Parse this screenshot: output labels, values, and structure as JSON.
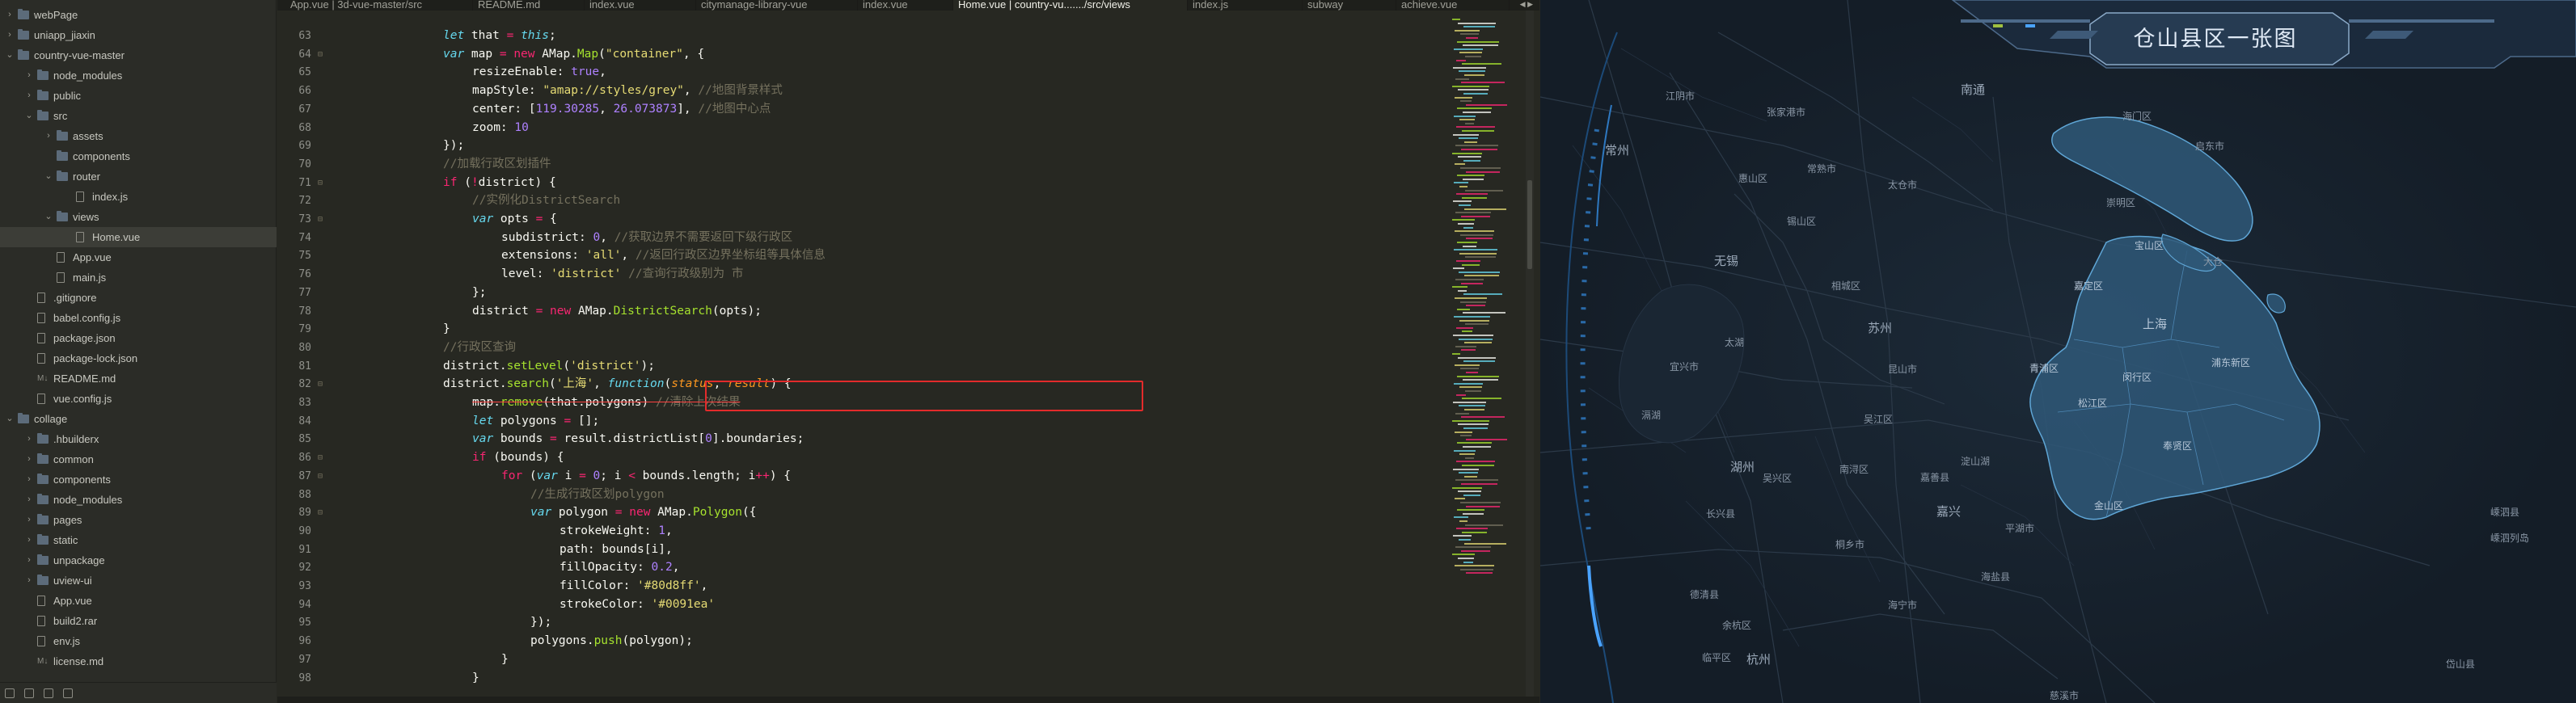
{
  "sidebar": {
    "items": [
      {
        "label": "webPage",
        "type": "folder",
        "depth": 0,
        "arrow": "›"
      },
      {
        "label": "uniapp_jiaxin",
        "type": "folder",
        "depth": 0,
        "arrow": "›"
      },
      {
        "label": "country-vue-master",
        "type": "folder",
        "depth": 0,
        "arrow": "⌄"
      },
      {
        "label": "node_modules",
        "type": "folder",
        "depth": 1,
        "arrow": "›"
      },
      {
        "label": "public",
        "type": "folder",
        "depth": 1,
        "arrow": "›"
      },
      {
        "label": "src",
        "type": "folder",
        "depth": 1,
        "arrow": "⌄"
      },
      {
        "label": "assets",
        "type": "folder",
        "depth": 2,
        "arrow": "›"
      },
      {
        "label": "components",
        "type": "folder",
        "depth": 2,
        "arrow": ""
      },
      {
        "label": "router",
        "type": "folder",
        "depth": 2,
        "arrow": "⌄"
      },
      {
        "label": "index.js",
        "type": "file",
        "depth": 3,
        "arrow": ""
      },
      {
        "label": "views",
        "type": "folder",
        "depth": 2,
        "arrow": "⌄"
      },
      {
        "label": "Home.vue",
        "type": "file",
        "depth": 3,
        "arrow": "",
        "selected": true
      },
      {
        "label": "App.vue",
        "type": "file",
        "depth": 2,
        "arrow": ""
      },
      {
        "label": "main.js",
        "type": "file",
        "depth": 2,
        "arrow": ""
      },
      {
        "label": ".gitignore",
        "type": "file",
        "depth": 1,
        "arrow": ""
      },
      {
        "label": "babel.config.js",
        "type": "file",
        "depth": 1,
        "arrow": ""
      },
      {
        "label": "package.json",
        "type": "json",
        "depth": 1,
        "arrow": ""
      },
      {
        "label": "package-lock.json",
        "type": "json",
        "depth": 1,
        "arrow": ""
      },
      {
        "label": "README.md",
        "type": "md",
        "depth": 1,
        "arrow": ""
      },
      {
        "label": "vue.config.js",
        "type": "file",
        "depth": 1,
        "arrow": ""
      },
      {
        "label": "collage",
        "type": "folder",
        "depth": 0,
        "arrow": "⌄"
      },
      {
        "label": ".hbuilderx",
        "type": "folder",
        "depth": 1,
        "arrow": "›"
      },
      {
        "label": "common",
        "type": "folder",
        "depth": 1,
        "arrow": "›"
      },
      {
        "label": "components",
        "type": "folder",
        "depth": 1,
        "arrow": "›"
      },
      {
        "label": "node_modules",
        "type": "folder",
        "depth": 1,
        "arrow": "›"
      },
      {
        "label": "pages",
        "type": "folder",
        "depth": 1,
        "arrow": "›"
      },
      {
        "label": "static",
        "type": "folder",
        "depth": 1,
        "arrow": "›"
      },
      {
        "label": "unpackage",
        "type": "folder",
        "depth": 1,
        "arrow": "›"
      },
      {
        "label": "uview-ui",
        "type": "folder",
        "depth": 1,
        "arrow": "›"
      },
      {
        "label": "App.vue",
        "type": "file",
        "depth": 1,
        "arrow": ""
      },
      {
        "label": "build2.rar",
        "type": "file",
        "depth": 1,
        "arrow": ""
      },
      {
        "label": "env.js",
        "type": "file",
        "depth": 1,
        "arrow": ""
      },
      {
        "label": "license.md",
        "type": "md",
        "depth": 1,
        "arrow": ""
      }
    ]
  },
  "tabs": [
    {
      "label": "App.vue | 3d-vue-master/src",
      "active": false
    },
    {
      "label": "README.md",
      "active": false
    },
    {
      "label": "index.vue",
      "active": false
    },
    {
      "label": "citymanage-library-vue",
      "active": false
    },
    {
      "label": "index.vue",
      "active": false
    },
    {
      "label": "Home.vue | country-vu......./src/views",
      "active": true
    },
    {
      "label": "index.js",
      "active": false
    },
    {
      "label": "subway",
      "active": false
    },
    {
      "label": "achieve.vue",
      "active": false
    }
  ],
  "tabs_scroll": "◀ ▶",
  "editor": {
    "code": [
      {
        "n": "63",
        "fold": "",
        "indent": 0,
        "html": "<span class='kw'>let</span> that <span class='op'>=</span> <span class='kw'>this</span>;"
      },
      {
        "n": "64",
        "fold": "⊟",
        "indent": 0,
        "html": "<span class='kw'>var</span> map <span class='op'>=</span> <span class='op'>new</span> AMap.<span class='fn'>Map</span>(<span class='str'>\"container\"</span>, {"
      },
      {
        "n": "65",
        "fold": "",
        "indent": 1,
        "html": "resizeEnable: <span class='num'>true</span>,"
      },
      {
        "n": "66",
        "fold": "",
        "indent": 1,
        "html": "mapStyle: <span class='str'>\"amap://styles/grey\"</span>, <span class='cm'>//地图背景样式</span>"
      },
      {
        "n": "67",
        "fold": "",
        "indent": 1,
        "html": "center: [<span class='num'>119.30285</span>, <span class='num'>26.073873</span>], <span class='cm'>//地图中心点</span>"
      },
      {
        "n": "68",
        "fold": "",
        "indent": 1,
        "html": "zoom: <span class='num'>10</span>"
      },
      {
        "n": "69",
        "fold": "",
        "indent": 0,
        "html": "});"
      },
      {
        "n": "70",
        "fold": "",
        "indent": 0,
        "html": "<span class='cm'>//加载行政区划插件</span>"
      },
      {
        "n": "71",
        "fold": "⊟",
        "indent": 0,
        "html": "<span class='op'>if</span> (<span class='op'>!</span>district) {"
      },
      {
        "n": "72",
        "fold": "",
        "indent": 1,
        "html": "<span class='cm'>//实例化DistrictSearch</span>"
      },
      {
        "n": "73",
        "fold": "⊟",
        "indent": 1,
        "html": "<span class='kw'>var</span> opts <span class='op'>=</span> {"
      },
      {
        "n": "74",
        "fold": "",
        "indent": 2,
        "html": "subdistrict: <span class='num'>0</span>, <span class='cm'>//获取边界不需要返回下级行政区</span>"
      },
      {
        "n": "75",
        "fold": "",
        "indent": 2,
        "html": "extensions: <span class='str'>'all'</span>, <span class='cm'>//返回行政区边界坐标组等具体信息</span>"
      },
      {
        "n": "76",
        "fold": "",
        "indent": 2,
        "html": "level: <span class='str'>'district'</span> <span class='cm'>//查询行政级别为 市</span>"
      },
      {
        "n": "77",
        "fold": "",
        "indent": 1,
        "html": "};"
      },
      {
        "n": "78",
        "fold": "",
        "indent": 1,
        "html": "district <span class='op'>=</span> <span class='op'>new</span> AMap.<span class='fn'>DistrictSearch</span>(opts);"
      },
      {
        "n": "79",
        "fold": "",
        "indent": 0,
        "html": "}"
      },
      {
        "n": "80",
        "fold": "",
        "indent": 0,
        "html": "<span class='cm'>//行政区查询</span>"
      },
      {
        "n": "81",
        "fold": "",
        "indent": 0,
        "html": "district.<span class='fn'>setLevel</span>(<span class='str'>'district'</span>);"
      },
      {
        "n": "82",
        "fold": "⊟",
        "indent": 0,
        "html": "district.<span class='fn'>search</span>(<span class='str'>'上海'</span>, <span class='kw'>function</span>(<span class='prm'>status</span>, <span class='prm'>result</span>) {"
      },
      {
        "n": "83",
        "fold": "",
        "indent": 1,
        "html": "<span class='strike'>map.<span class='fn'>remove</span>(that.polygons) <span class='cm'>//清除上次结果</span></span>"
      },
      {
        "n": "84",
        "fold": "",
        "indent": 1,
        "html": "<span class='kw'>let</span> polygons <span class='op'>=</span> [];"
      },
      {
        "n": "85",
        "fold": "",
        "indent": 1,
        "html": "<span class='kw'>var</span> bounds <span class='op'>=</span> result.districtList[<span class='num'>0</span>].boundaries;"
      },
      {
        "n": "86",
        "fold": "⊟",
        "indent": 1,
        "html": "<span class='op'>if</span> (bounds) {"
      },
      {
        "n": "87",
        "fold": "⊟",
        "indent": 2,
        "html": "<span class='op'>for</span> (<span class='kw'>var</span> i <span class='op'>=</span> <span class='num'>0</span>; i <span class='op'>&lt;</span> bounds.length; i<span class='op'>++</span>) {"
      },
      {
        "n": "88",
        "fold": "",
        "indent": 3,
        "html": "<span class='cm'>//生成行政区划polygon</span>"
      },
      {
        "n": "89",
        "fold": "⊟",
        "indent": 3,
        "html": "<span class='kw'>var</span> polygon <span class='op'>=</span> <span class='op'>new</span> AMap.<span class='fn'>Polygon</span>({"
      },
      {
        "n": "90",
        "fold": "",
        "indent": 4,
        "html": "strokeWeight: <span class='num'>1</span>,"
      },
      {
        "n": "91",
        "fold": "",
        "indent": 4,
        "html": "path: bounds[i],"
      },
      {
        "n": "92",
        "fold": "",
        "indent": 4,
        "html": "fillOpacity: <span class='num'>0.2</span>,"
      },
      {
        "n": "93",
        "fold": "",
        "indent": 4,
        "html": "fillColor: <span class='str'>'#80d8ff'</span>,"
      },
      {
        "n": "94",
        "fold": "",
        "indent": 4,
        "html": "strokeColor: <span class='str'>'#0091ea'</span>"
      },
      {
        "n": "95",
        "fold": "",
        "indent": 3,
        "html": "});"
      },
      {
        "n": "96",
        "fold": "",
        "indent": 3,
        "html": "polygons.<span class='fn'>push</span>(polygon);"
      },
      {
        "n": "97",
        "fold": "",
        "indent": 2,
        "html": "}"
      },
      {
        "n": "98",
        "fold": "",
        "indent": 1,
        "html": "}"
      }
    ]
  },
  "map": {
    "title": "仓山县区一张图",
    "labels": [
      {
        "t": "南通",
        "cls": "big"
      },
      {
        "t": "海门区",
        "cls": ""
      },
      {
        "t": "启东市",
        "cls": ""
      },
      {
        "t": "江阴市",
        "cls": ""
      },
      {
        "t": "张家港市",
        "cls": ""
      },
      {
        "t": "常熟市",
        "cls": ""
      },
      {
        "t": "太仓市",
        "cls": ""
      },
      {
        "t": "崇明区",
        "cls": ""
      },
      {
        "t": "常州",
        "cls": "big"
      },
      {
        "t": "无锡",
        "cls": "big"
      },
      {
        "t": "惠山区",
        "cls": ""
      },
      {
        "t": "锡山区",
        "cls": ""
      },
      {
        "t": "苏州",
        "cls": "big"
      },
      {
        "t": "相城区",
        "cls": ""
      },
      {
        "t": "昆山市",
        "cls": ""
      },
      {
        "t": "吴江区",
        "cls": ""
      },
      {
        "t": "宝山区",
        "cls": "sh"
      },
      {
        "t": "嘉定区",
        "cls": "sh"
      },
      {
        "t": "上海",
        "cls": "big sh"
      },
      {
        "t": "青浦区",
        "cls": "sh"
      },
      {
        "t": "闵行区",
        "cls": "sh"
      },
      {
        "t": "松江区",
        "cls": "sh"
      },
      {
        "t": "奉贤区",
        "cls": "sh"
      },
      {
        "t": "金山区",
        "cls": "sh"
      },
      {
        "t": "浦东新区",
        "cls": "sh"
      },
      {
        "t": "湖州",
        "cls": "big"
      },
      {
        "t": "吴兴区",
        "cls": ""
      },
      {
        "t": "南浔区",
        "cls": ""
      },
      {
        "t": "嘉善县",
        "cls": ""
      },
      {
        "t": "嘉兴",
        "cls": "big"
      },
      {
        "t": "平湖市",
        "cls": ""
      },
      {
        "t": "桐乡市",
        "cls": ""
      },
      {
        "t": "海盐县",
        "cls": ""
      },
      {
        "t": "海宁市",
        "cls": ""
      },
      {
        "t": "长兴县",
        "cls": ""
      },
      {
        "t": "德清县",
        "cls": ""
      },
      {
        "t": "杭州",
        "cls": "big"
      },
      {
        "t": "余杭区",
        "cls": ""
      },
      {
        "t": "临平区",
        "cls": ""
      },
      {
        "t": "嵊泗县",
        "cls": ""
      },
      {
        "t": "嵊泗列岛",
        "cls": ""
      },
      {
        "t": "岱山县",
        "cls": ""
      },
      {
        "t": "大仓",
        "cls": ""
      },
      {
        "t": "宜兴市",
        "cls": ""
      },
      {
        "t": "滆湖",
        "cls": ""
      },
      {
        "t": "太湖",
        "cls": ""
      },
      {
        "t": "淀山湖",
        "cls": ""
      },
      {
        "t": "慈溪市",
        "cls": ""
      }
    ]
  },
  "colors": {
    "accent_red": "#e32b2b",
    "map_fill": "#3b6d93",
    "map_stroke": "#5fa6d6"
  }
}
